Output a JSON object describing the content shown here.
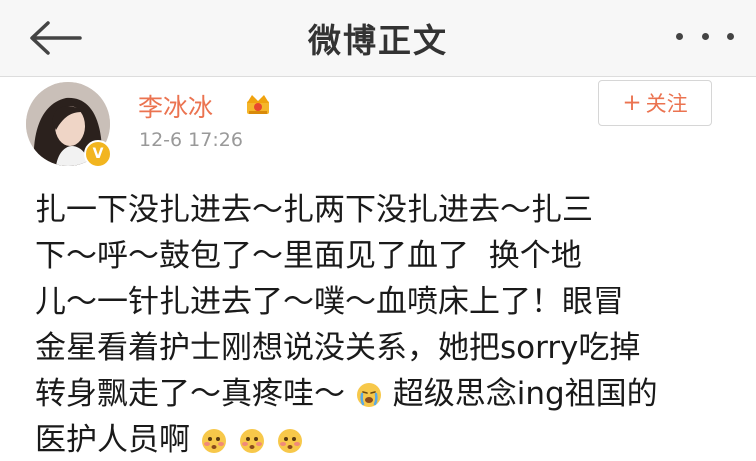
{
  "nav": {
    "title": "微博正文"
  },
  "author": {
    "name": "李冰冰",
    "timestamp": "12-6 17:26",
    "verified_badge": "V"
  },
  "follow_button": {
    "plus": "+",
    "label": "关注"
  },
  "post": {
    "lines": [
      {
        "segments": [
          "扎一下没扎进去～扎两下没扎进去～扎三"
        ]
      },
      {
        "segments": [
          "下～呼～鼓包了～里面见了血了  换个地"
        ]
      },
      {
        "segments": [
          "儿～一针扎进去了～噗～血喷床上了！眼冒"
        ]
      },
      {
        "segments": [
          "金星看着护士刚想说没关系，她把sorry吃掉"
        ]
      },
      {
        "segments": [
          "转身飘走了～真疼哇～",
          "超级思念ing祖国的"
        ]
      },
      {
        "segments": [
          "医护人员啊"
        ]
      }
    ]
  },
  "icons": {
    "back": "back-arrow-icon",
    "more": "more-icon",
    "crown": "crown-icon",
    "cry_emoji": "crying-emoji-icon",
    "shy_emoji": "blushing-emoji-icon"
  },
  "colors": {
    "accent": "#eb7350",
    "nav_bg": "#f7f7f7",
    "text": "#1a1a1a",
    "meta": "#999999",
    "badge": "#f2b51f"
  }
}
